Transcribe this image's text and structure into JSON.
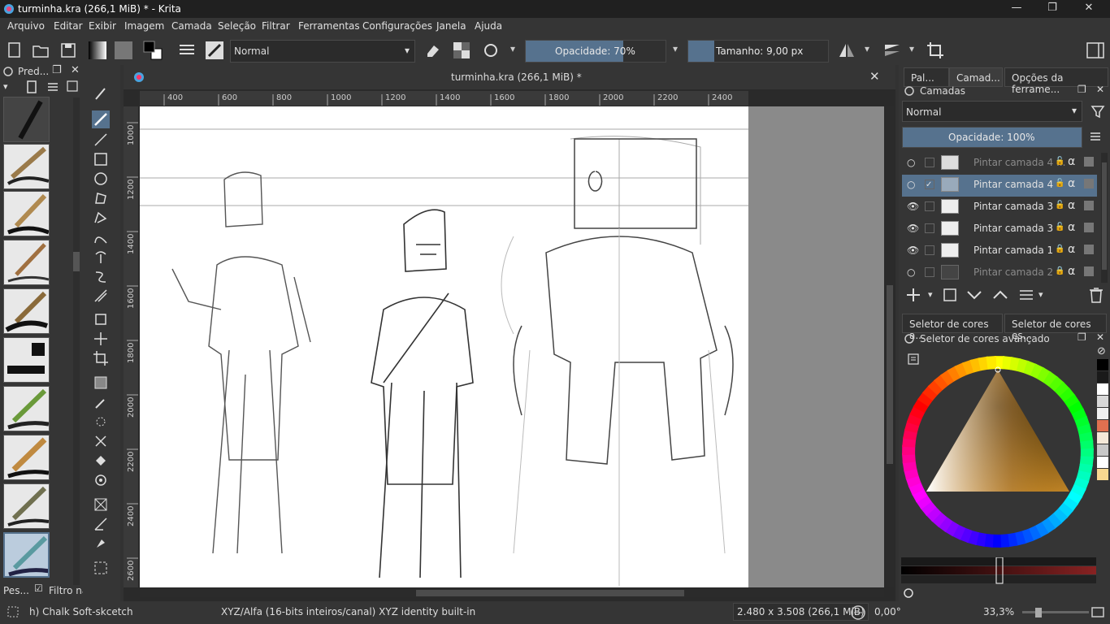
{
  "window": {
    "title": "turminha.kra (266,1 MiB) * - Krita",
    "minimize": "—",
    "maximize": "❐",
    "close": "✕"
  },
  "menu": [
    "Arquivo",
    "Editar",
    "Exibir",
    "Imagem",
    "Camada",
    "Seleção",
    "Filtrar",
    "Ferramentas",
    "Configurações",
    "Janela",
    "Ajuda"
  ],
  "toolbar": {
    "blend_mode": "Normal",
    "opacity_label": "Opacidade: 70%",
    "opacity_value": 0.7,
    "size_label": "Tamanho: 9,00 px"
  },
  "left_dock": {
    "title": "Pred...",
    "footer_left": "Pes...",
    "footer_filter": "Filtro na"
  },
  "document": {
    "tab_title": "turminha.kra (266,1 MiB) *"
  },
  "rulers": {
    "h_ticks": [
      "400",
      "600",
      "800",
      "1000",
      "1200",
      "1400",
      "1600",
      "1800",
      "2000",
      "2200",
      "2400"
    ],
    "v_ticks": [
      "1000",
      "1200",
      "1400",
      "1600",
      "1800",
      "2000",
      "2200",
      "2400",
      "2600"
    ]
  },
  "right_dock": {
    "tabs": [
      "Pal...",
      "Camad...",
      "Opções da ferrame..."
    ],
    "layers_title": "Camadas",
    "blend_mode": "Normal",
    "opacity_label": "Opacidade:  100%",
    "opacity_value": 1.0,
    "layers": [
      {
        "name": "Pintar camada 4 ...",
        "visible": false,
        "selected": false,
        "locked": false,
        "dim": true
      },
      {
        "name": "Pintar camada 4",
        "visible": false,
        "selected": true,
        "locked": false,
        "dim": false
      },
      {
        "name": "Pintar camada 3",
        "visible": true,
        "selected": false,
        "locked": false,
        "dim": false
      },
      {
        "name": "Pintar camada 3",
        "visible": true,
        "selected": false,
        "locked": false,
        "dim": false
      },
      {
        "name": "Pintar camada 1",
        "visible": true,
        "selected": false,
        "locked": true,
        "dim": false
      },
      {
        "name": "Pintar camada 2",
        "visible": false,
        "selected": false,
        "locked": true,
        "dim": true
      }
    ],
    "color_tabs": [
      "Seletor de cores a...",
      "Seletor de cores es..."
    ],
    "color_title": "Seletor de cores avançado",
    "swatches": [
      "#000000",
      "#1a1a1a",
      "#ffffff",
      "#d8d8d8",
      "#f0f0f0",
      "#e07050",
      "#f4e8d8",
      "#c8c8c8",
      "#ffffff",
      "#f8d890"
    ]
  },
  "status": {
    "brush": "h) Chalk Soft-skcetch",
    "colorspace": "XYZ/Alfa (16-bits inteiros/canal)  XYZ identity built-in",
    "dims": "2.480 x 3.508 (266,1 MiB)",
    "rotation": "0,00°",
    "zoom": "33,3%"
  },
  "colors": {
    "accent": "#56728e",
    "bg": "#353535"
  }
}
